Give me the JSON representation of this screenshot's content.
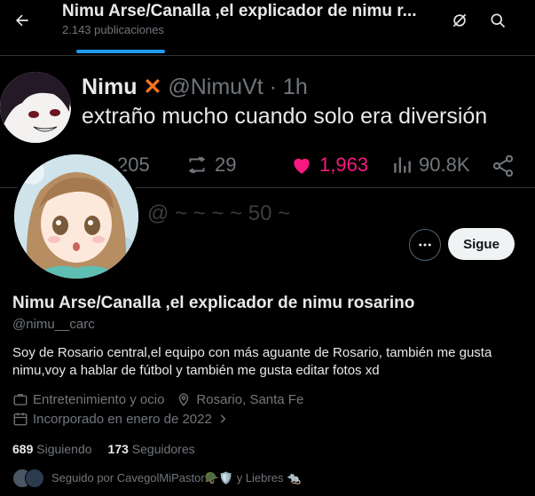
{
  "header": {
    "title": "Nimu Arse/Canalla ,el explicador de nimu r...",
    "posts_count": "2.143 publicaciones"
  },
  "banner": {
    "name": "Nimu",
    "x_mark": "✕",
    "handle": "@NimuVt · 1h",
    "text": "extraño mucho cuando solo era diversión",
    "replies": "205",
    "reposts": "29",
    "likes": "1,963",
    "views": "90.8K",
    "next_post_fragment": "@ ~ ~ ~ ~ 50 ~"
  },
  "profile": {
    "name": "Nimu Arse/Canalla ,el explicador de nimu rosarino",
    "handle": "@nimu__carc",
    "bio": "Soy de Rosario central,el equipo con más aguante de Rosario, también me gusta nimu,voy a hablar de fútbol y también me gusta editar fotos xd",
    "category": "Entretenimiento y ocio",
    "location": "Rosario, Santa Fe",
    "joined": "Incorporado en enero de 2022",
    "following_count": "689",
    "following_label": "Siguiendo",
    "followers_count": "173",
    "followers_label": "Seguidores",
    "followed_by": "Seguido por CavegolMiPastor🪖🛡️ y Liebres 🐀",
    "follow_label": "Sigue"
  },
  "colors": {
    "accent": "#1d9bf0",
    "like": "#f91880",
    "muted": "#71767b"
  }
}
